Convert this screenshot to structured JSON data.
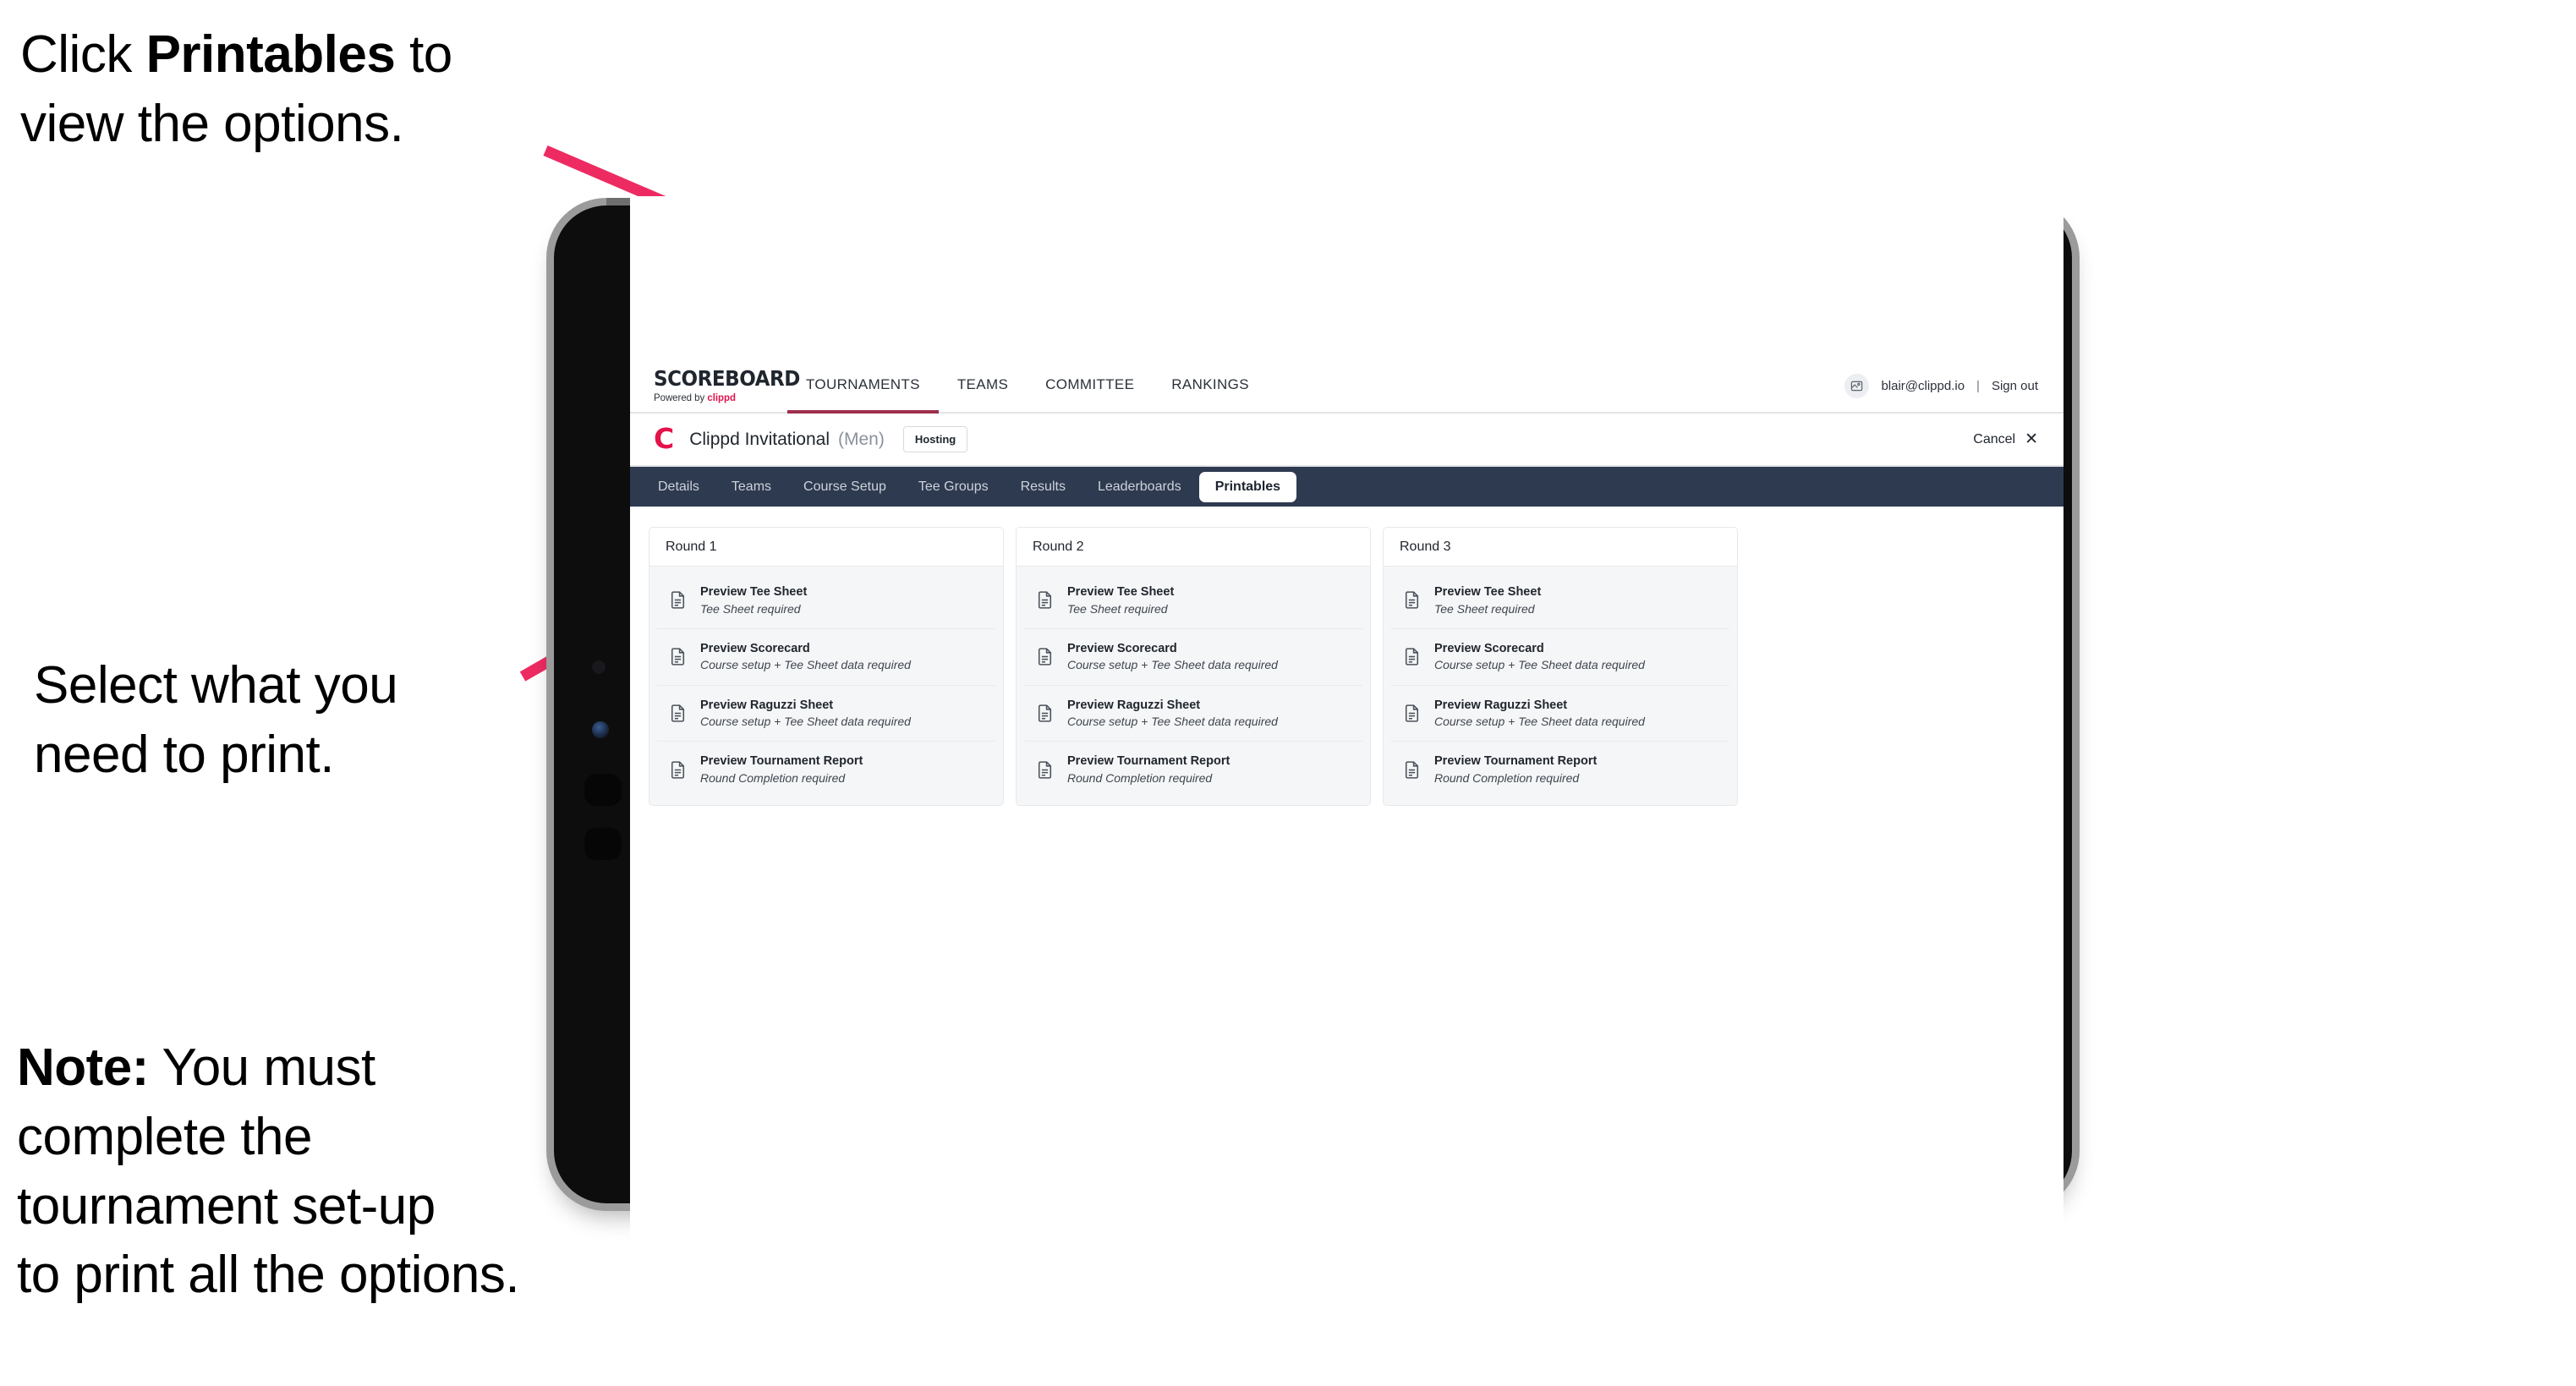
{
  "callouts": [
    {
      "id": "click-printables",
      "segments": [
        {
          "text": "Click ",
          "bold": false
        },
        {
          "text": "Printables",
          "bold": true
        },
        {
          "text": " to\nview the options.",
          "bold": false
        }
      ],
      "plain": "Click Printables to\nview the options."
    },
    {
      "id": "select-what-to-print",
      "plain": "Select what you\n need to print."
    },
    {
      "id": "note-complete-setup",
      "segments": [
        {
          "text": "Note:",
          "bold": true
        },
        {
          "text": " You must\ncomplete the\ntournament set-up\nto print all the options.",
          "bold": false
        }
      ],
      "plain": "Note: You must\ncomplete the\ntournament set-up\nto print all the options."
    }
  ],
  "app": {
    "brand": {
      "wordmark": "SCOREBOARD",
      "powered_prefix": "Powered by ",
      "powered_brand": "clippd"
    },
    "main_nav": [
      {
        "label": "TOURNAMENTS",
        "active": true
      },
      {
        "label": "TEAMS",
        "active": false
      },
      {
        "label": "COMMITTEE",
        "active": false
      },
      {
        "label": "RANKINGS",
        "active": false
      }
    ],
    "user": {
      "avatar_icon": "user-avatar-icon",
      "email": "blair@clippd.io",
      "separator": "|",
      "sign_out": "Sign out"
    },
    "tournament": {
      "mark": "C",
      "name": "Clippd Invitational",
      "gender": "(Men)",
      "status_badge": "Hosting",
      "cancel_label": "Cancel",
      "cancel_icon": "close-icon"
    },
    "sub_nav": [
      {
        "label": "Details",
        "active": false
      },
      {
        "label": "Teams",
        "active": false
      },
      {
        "label": "Course Setup",
        "active": false
      },
      {
        "label": "Tee Groups",
        "active": false
      },
      {
        "label": "Results",
        "active": false
      },
      {
        "label": "Leaderboards",
        "active": false
      },
      {
        "label": "Printables",
        "active": true
      }
    ],
    "rounds": [
      {
        "title": "Round 1",
        "items": [
          {
            "icon": "document-icon",
            "title": "Preview Tee Sheet",
            "subtitle": "Tee Sheet required"
          },
          {
            "icon": "document-icon",
            "title": "Preview Scorecard",
            "subtitle": "Course setup + Tee Sheet data required"
          },
          {
            "icon": "document-icon",
            "title": "Preview Raguzzi Sheet",
            "subtitle": "Course setup + Tee Sheet data required"
          },
          {
            "icon": "document-icon",
            "title": "Preview Tournament Report",
            "subtitle": "Round Completion required"
          }
        ]
      },
      {
        "title": "Round 2",
        "items": [
          {
            "icon": "document-icon",
            "title": "Preview Tee Sheet",
            "subtitle": "Tee Sheet required"
          },
          {
            "icon": "document-icon",
            "title": "Preview Scorecard",
            "subtitle": "Course setup + Tee Sheet data required"
          },
          {
            "icon": "document-icon",
            "title": "Preview Raguzzi Sheet",
            "subtitle": "Course setup + Tee Sheet data required"
          },
          {
            "icon": "document-icon",
            "title": "Preview Tournament Report",
            "subtitle": "Round Completion required"
          }
        ]
      },
      {
        "title": "Round 3",
        "items": [
          {
            "icon": "document-icon",
            "title": "Preview Tee Sheet",
            "subtitle": "Tee Sheet required"
          },
          {
            "icon": "document-icon",
            "title": "Preview Scorecard",
            "subtitle": "Course setup + Tee Sheet data required"
          },
          {
            "icon": "document-icon",
            "title": "Preview Raguzzi Sheet",
            "subtitle": "Course setup + Tee Sheet data required"
          },
          {
            "icon": "document-icon",
            "title": "Preview Tournament Report",
            "subtitle": "Round Completion required"
          }
        ]
      }
    ]
  },
  "colors": {
    "arrow_pink": "#ED2B62",
    "brand_crimson": "#E5124A",
    "subnav_navy": "#2E3A4F",
    "active_tab_underline": "#9D2F4C",
    "card_bg": "#F5F6F7",
    "bezel_black": "#0D0D0D",
    "bezel_silver": "#9B9B9B"
  }
}
